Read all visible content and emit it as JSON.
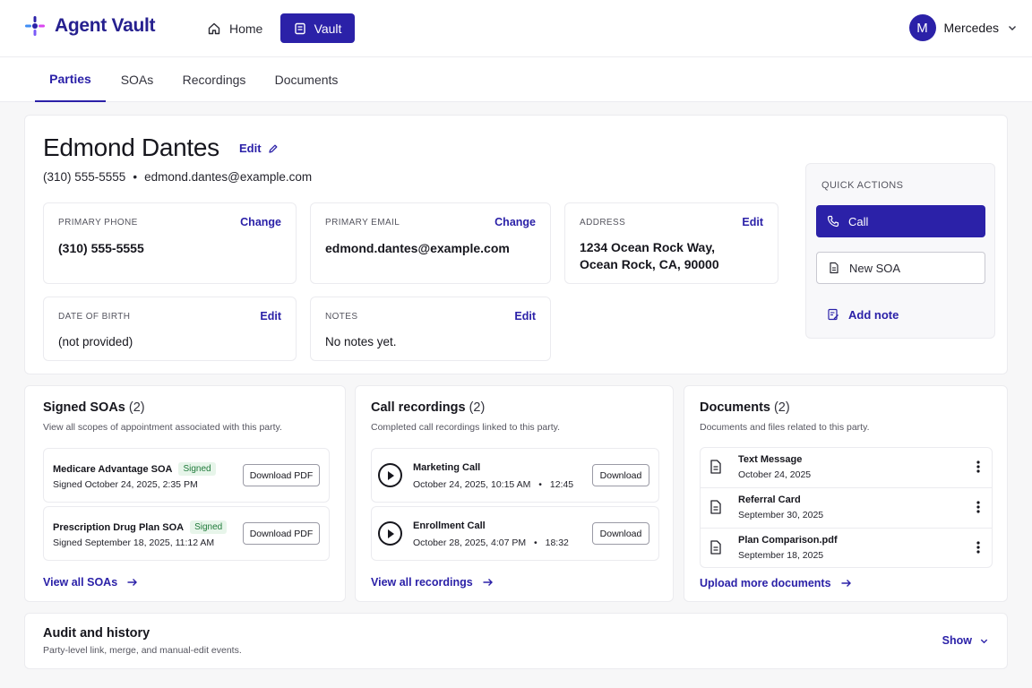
{
  "header": {
    "app_name": "Agent Vault",
    "nav": {
      "home": "Home",
      "vault": "Vault"
    },
    "user": {
      "initial": "M",
      "name": "Mercedes"
    }
  },
  "tabs": [
    {
      "label": "Parties",
      "active": true
    },
    {
      "label": "SOAs",
      "active": false
    },
    {
      "label": "Recordings",
      "active": false
    },
    {
      "label": "Documents",
      "active": false
    }
  ],
  "party": {
    "name": "Edmond Dantes",
    "edit_label": "Edit",
    "phone": "(310) 555-5555",
    "separator": "•",
    "email": "edmond.dantes@example.com",
    "fields": {
      "primary_phone": {
        "label": "PRIMARY PHONE",
        "action": "Change",
        "value": "(310) 555-5555"
      },
      "primary_email": {
        "label": "PRIMARY EMAIL",
        "action": "Change",
        "value": "edmond.dantes@example.com"
      },
      "address": {
        "label": "ADDRESS",
        "action": "Edit",
        "line1": "1234 Ocean Rock Way,",
        "line2": "Ocean Rock, CA, 90000"
      },
      "dob": {
        "label": "DATE OF BIRTH",
        "action": "Edit",
        "value": "(not provided)"
      },
      "notes": {
        "label": "NOTES",
        "action": "Edit",
        "value": "No notes yet."
      }
    }
  },
  "quick_actions": {
    "title": "QUICK ACTIONS",
    "call": "Call",
    "new_soa": "New SOA",
    "add_note": "Add note"
  },
  "soas": {
    "title": "Signed SOAs",
    "count": "(2)",
    "subtitle": "View all scopes of appointment associated with this party.",
    "items": [
      {
        "title": "Medicare Advantage SOA",
        "badge": "Signed",
        "signed": "Signed October 24, 2025, 2:35 PM",
        "button": "Download PDF"
      },
      {
        "title": "Prescription Drug Plan SOA",
        "badge": "Signed",
        "signed": "Signed September 18, 2025, 11:12 AM",
        "button": "Download PDF"
      }
    ],
    "link": "View all SOAs"
  },
  "recordings": {
    "title": "Call recordings",
    "count": "(2)",
    "subtitle": "Completed call recordings linked to this party.",
    "items": [
      {
        "title": "Marketing Call",
        "date": "October 24, 2025, 10:15 AM",
        "duration": "12:45",
        "button": "Download"
      },
      {
        "title": "Enrollment Call",
        "date": "October 28, 2025, 4:07 PM",
        "duration": "18:32",
        "button": "Download"
      }
    ],
    "link": "View all recordings"
  },
  "documents": {
    "title": "Documents",
    "count": "(2)",
    "subtitle": "Documents and files related to this party.",
    "items": [
      {
        "title": "Text Message",
        "date": "October 24, 2025"
      },
      {
        "title": "Referral Card",
        "date": "September 30, 2025"
      },
      {
        "title": "Plan Comparison.pdf",
        "date": "September 18, 2025"
      }
    ],
    "link": "Upload more documents"
  },
  "audit": {
    "title": "Audit and history",
    "subtitle": "Party-level link, merge, and manual-edit events.",
    "toggle": "Show"
  },
  "colors": {
    "accent": "#2b21a8",
    "badge_green": "#1f7a3a",
    "badge_bg": "#e7f5ea"
  }
}
